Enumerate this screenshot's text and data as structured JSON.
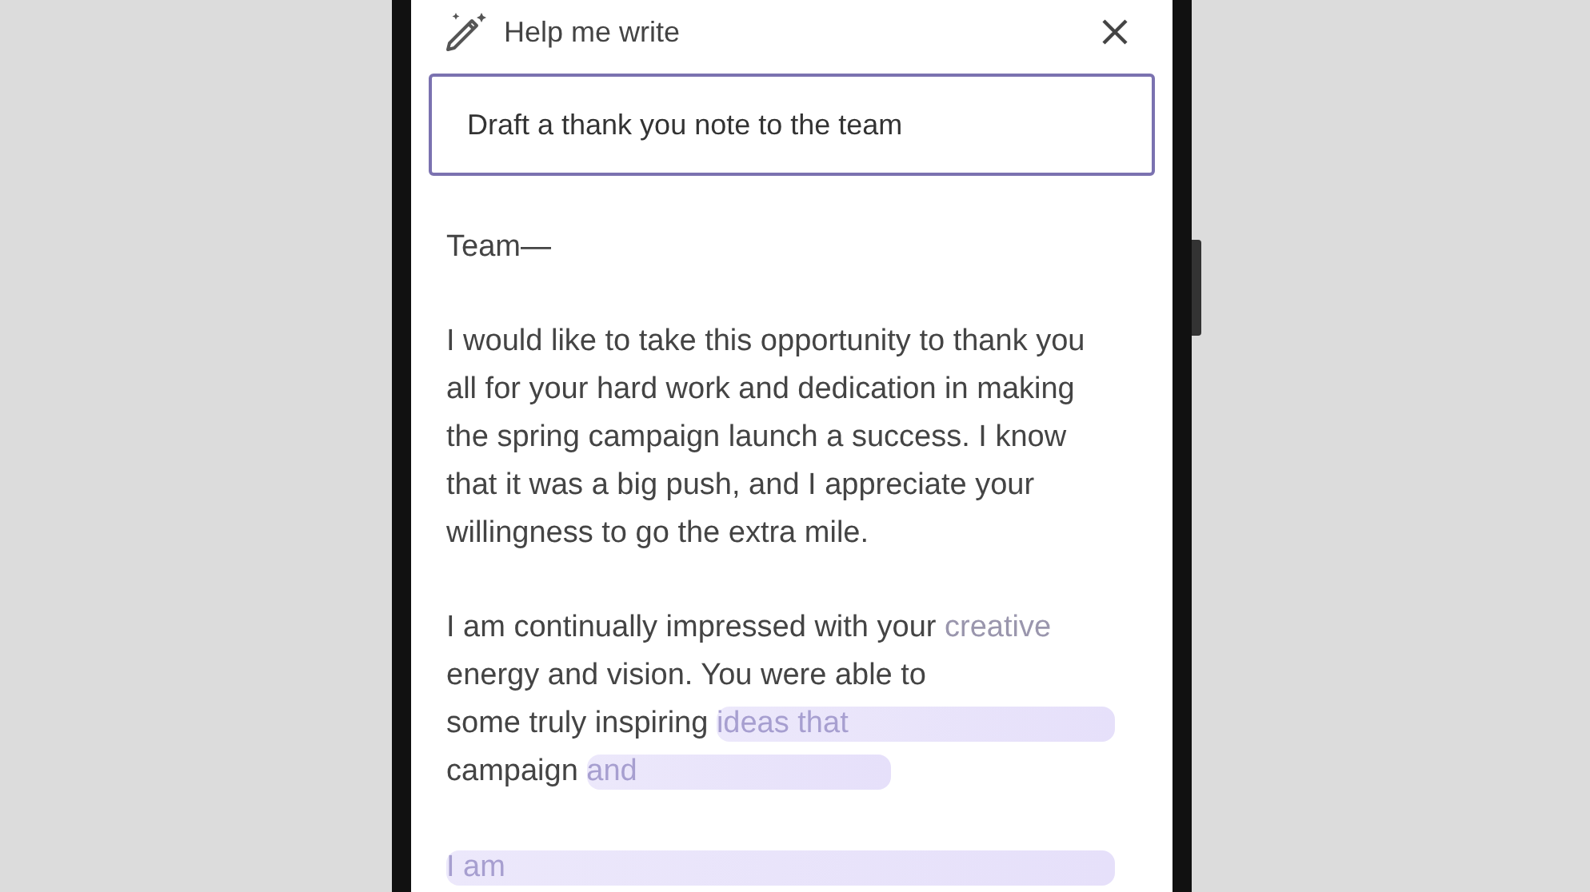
{
  "panel": {
    "title": "Help me write"
  },
  "prompt": {
    "value": "Draft a thank you note to the team"
  },
  "draft": {
    "greeting": "Team—",
    "paragraph": "I would like to take this opportunity to thank you all for your hard work and dedication in making the spring campaign launch a success. I know that it was a big push, and I appreciate your willingness to go the extra mile.",
    "generating_lines": [
      {
        "segments": [
          {
            "kind": "text",
            "text": "I am continually impressed with your "
          },
          {
            "kind": "faded",
            "text": "creative"
          }
        ]
      },
      {
        "segments": [
          {
            "kind": "text",
            "text": "energy and vision. You were able to"
          }
        ]
      },
      {
        "segments": [
          {
            "kind": "text",
            "text": "some truly inspiring "
          },
          {
            "kind": "highlight",
            "text": "ideas that"
          }
        ]
      },
      {
        "segments": [
          {
            "kind": "text",
            "text": "campaign "
          },
          {
            "kind": "highlight_short",
            "text": "and"
          }
        ]
      }
    ],
    "next_lines": [
      {
        "segments": [
          {
            "kind": "highlight",
            "text": "I am"
          }
        ]
      }
    ]
  }
}
